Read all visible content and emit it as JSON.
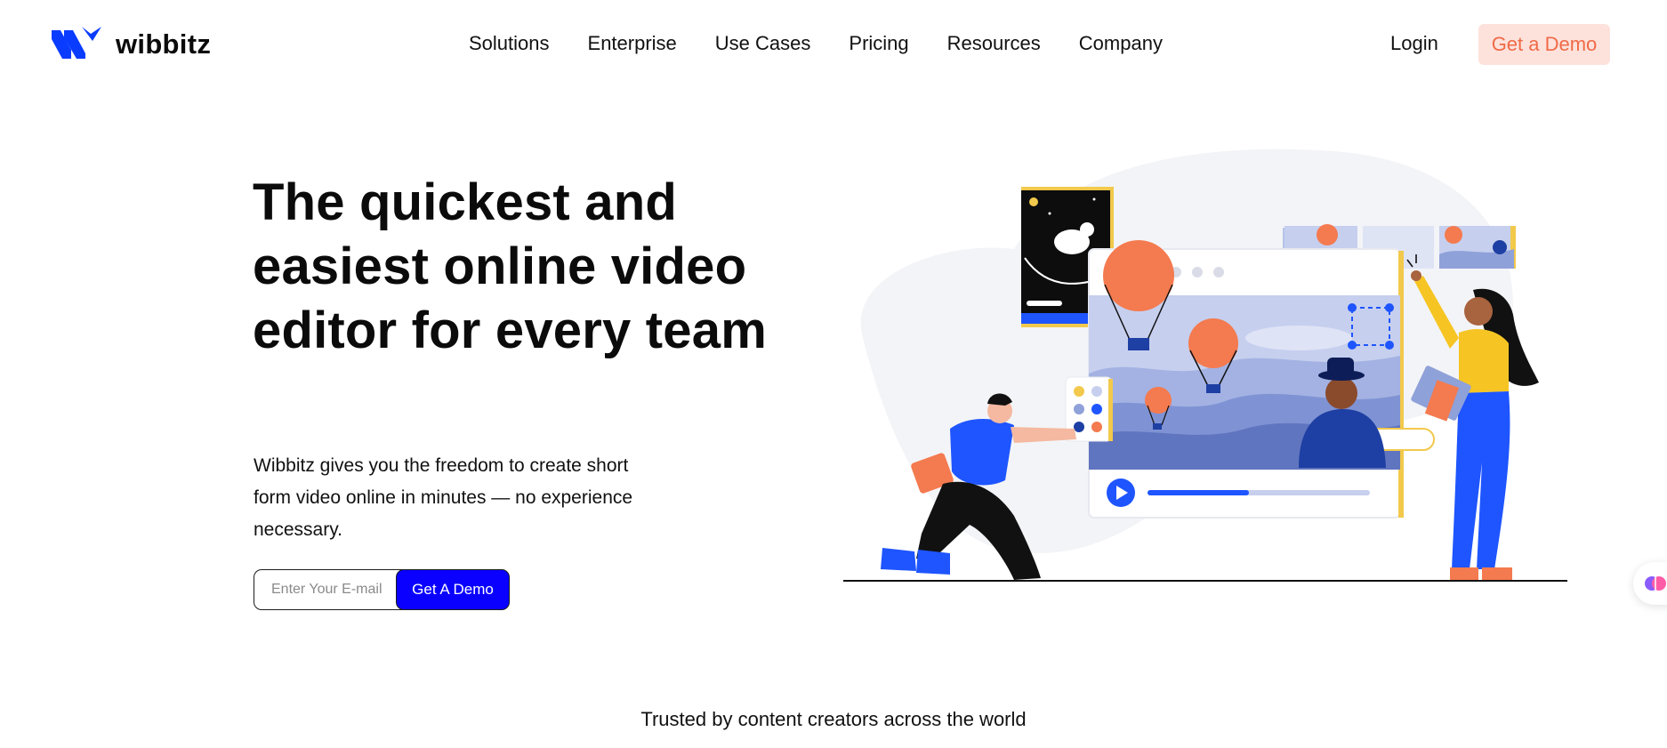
{
  "brand": {
    "name": "wibbitz",
    "logo_color": "#0a3cff"
  },
  "nav": {
    "items": [
      "Solutions",
      "Enterprise",
      "Use Cases",
      "Pricing",
      "Resources",
      "Company"
    ]
  },
  "header": {
    "login_label": "Login",
    "demo_label": "Get a Demo",
    "demo_bg": "#fde2dc",
    "demo_color": "#f06a47"
  },
  "hero": {
    "title": "The quickest and easiest online video editor for every team",
    "subtitle": "Wibbitz gives you the freedom to create short form video online in minutes — no experience necessary.",
    "email_placeholder": "Enter Your E-mail",
    "cta_label": "Get A Demo",
    "cta_color": "#0a00ff"
  },
  "trusted": {
    "text": "Trusted by content creators across the world"
  },
  "illustration": {
    "icons": [
      "astronaut-card",
      "hot-air-balloon",
      "video-player",
      "play-icon",
      "cursor-icon",
      "color-palette",
      "man-kneeling",
      "woman-pointing"
    ]
  }
}
